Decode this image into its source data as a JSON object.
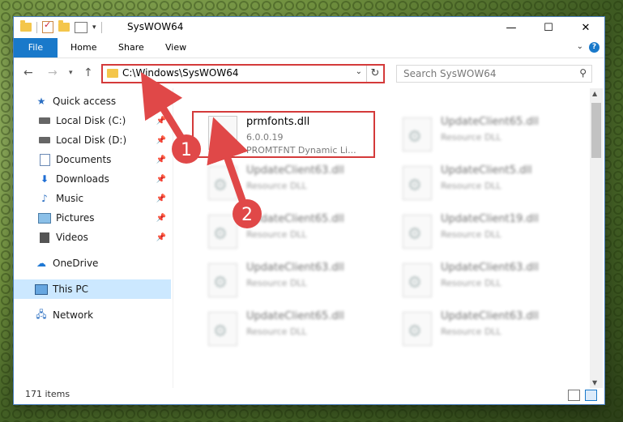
{
  "window": {
    "title": "SysWOW64",
    "minimize_glyph": "—",
    "maximize_glyph": "☐",
    "close_glyph": "✕"
  },
  "ribbon": {
    "tabs": [
      "File",
      "Home",
      "Share",
      "View"
    ],
    "help_glyph": "?"
  },
  "navigation": {
    "address": "C:\\Windows\\SysWOW64",
    "search_placeholder": "Search SysWOW64"
  },
  "sidebar": {
    "items": [
      {
        "label": "Quick access",
        "icon": "star-icon"
      },
      {
        "label": "Local Disk (C:)",
        "icon": "disk-icon",
        "pinned": true
      },
      {
        "label": "Local Disk (D:)",
        "icon": "disk-icon",
        "pinned": true
      },
      {
        "label": "Documents",
        "icon": "documents-icon",
        "pinned": true
      },
      {
        "label": "Downloads",
        "icon": "download-icon",
        "pinned": true
      },
      {
        "label": "Music",
        "icon": "music-icon",
        "pinned": true
      },
      {
        "label": "Pictures",
        "icon": "pictures-icon",
        "pinned": true
      },
      {
        "label": "Videos",
        "icon": "videos-icon",
        "pinned": true
      },
      {
        "label": "OneDrive",
        "icon": "cloud-icon"
      },
      {
        "label": "This PC",
        "icon": "computer-icon",
        "selected": true
      },
      {
        "label": "Network",
        "icon": "network-icon"
      }
    ]
  },
  "files": [
    {
      "name": "prmfonts.dll",
      "version": "6.0.0.19",
      "description": "PROMTFNT Dynamic Li...",
      "highlighted": true
    },
    {
      "name": "UpdateClient65.dll",
      "description": "Resource DLL"
    },
    {
      "name": "UpdateClient63.dll",
      "description": "Resource DLL"
    },
    {
      "name": "UpdateClient5.dll",
      "description": "Resource DLL"
    },
    {
      "name": "UpdateClient65.dll",
      "description": "Resource DLL"
    },
    {
      "name": "UpdateClient19.dll",
      "description": "Resource DLL"
    },
    {
      "name": "UpdateClient63.dll",
      "description": "Resource DLL"
    },
    {
      "name": "UpdateClient63.dll",
      "description": "Resource DLL"
    },
    {
      "name": "UpdateClient65.dll",
      "description": "Resource DLL"
    },
    {
      "name": "UpdateClient63.dll",
      "description": "Resource DLL"
    }
  ],
  "status": {
    "item_count": "171 items"
  },
  "annotations": {
    "step1": "1",
    "step2": "2"
  },
  "colors": {
    "accent": "#1979ca",
    "highlight": "#d43a3a",
    "selection": "#cce8ff"
  }
}
